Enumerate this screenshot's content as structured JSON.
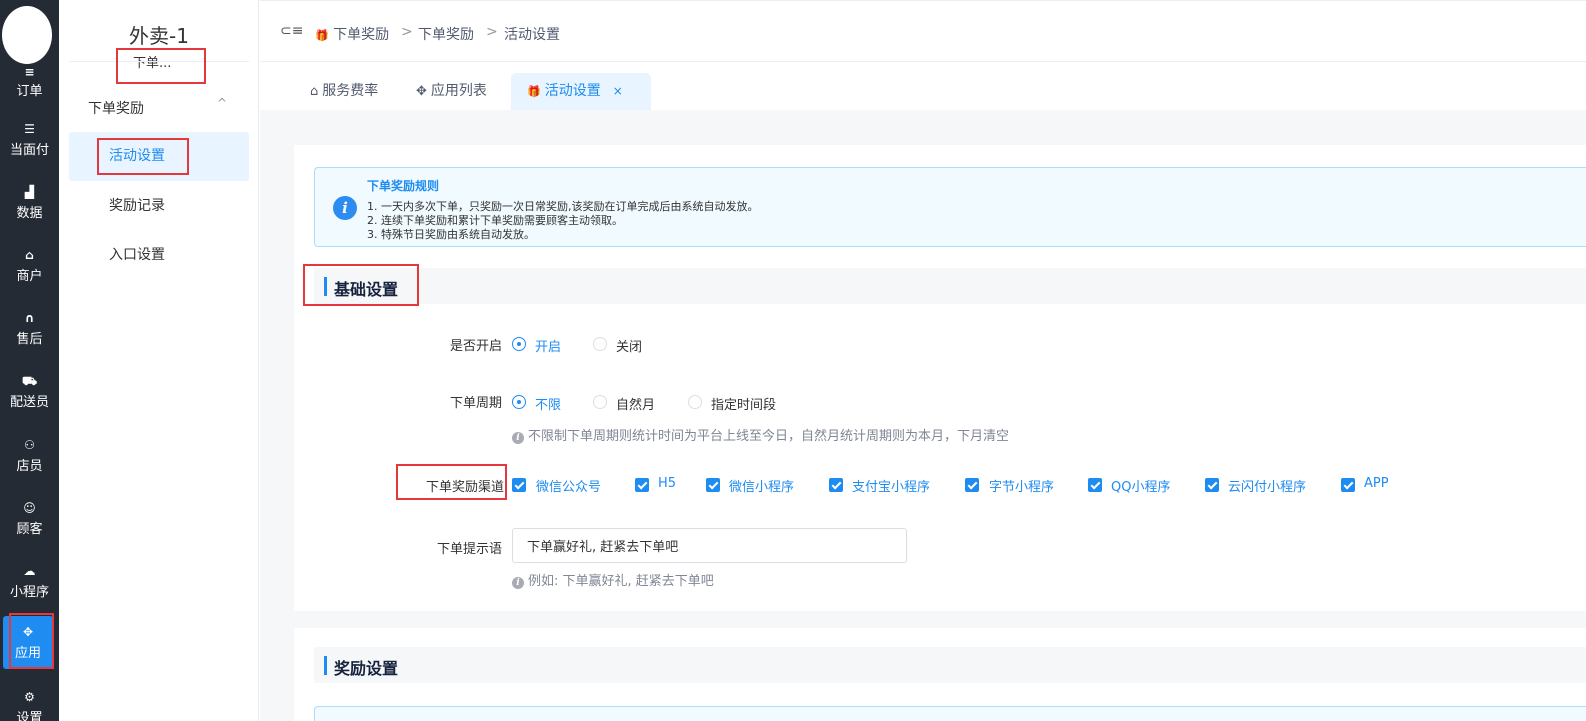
{
  "rail": {
    "items": [
      {
        "label": "订单",
        "icon": "list-icon",
        "glyph": "≡"
      },
      {
        "label": "当面付",
        "icon": "list-icon",
        "glyph": "☰"
      },
      {
        "label": "数据",
        "icon": "bar-chart-icon",
        "glyph": "▟"
      },
      {
        "label": "商户",
        "icon": "store-icon",
        "glyph": "⌂"
      },
      {
        "label": "售后",
        "icon": "headset-icon",
        "glyph": "∩"
      },
      {
        "label": "配送员",
        "icon": "scooter-icon",
        "glyph": "⛟"
      },
      {
        "label": "店员",
        "icon": "users-icon",
        "glyph": "⚇"
      },
      {
        "label": "顾客",
        "icon": "user-circle-icon",
        "glyph": "☺"
      },
      {
        "label": "小程序",
        "icon": "wechat-icon",
        "glyph": "☁"
      },
      {
        "label": "应用",
        "icon": "apps-icon",
        "glyph": "✥"
      },
      {
        "label": "设置",
        "icon": "user-settings-icon",
        "glyph": "⚙"
      }
    ],
    "active_color": "#1e8cf0",
    "bg_color": "#252b34"
  },
  "sidebar": {
    "store_name": "外卖-1",
    "store_sub": "下单...",
    "group_label": "下单奖励",
    "group_caret": "^",
    "items": [
      {
        "label": "活动设置",
        "active": true
      },
      {
        "label": "奖励记录",
        "active": false
      },
      {
        "label": "入口设置",
        "active": false
      }
    ]
  },
  "header": {
    "fold_icon": "⊂≡",
    "breadcrumb": [
      "下单奖励",
      "下单奖励",
      "活动设置"
    ],
    "sep": ">"
  },
  "tabs": [
    {
      "label": "服务费率",
      "icon": "store-icon",
      "glyph": "⌂",
      "active": false
    },
    {
      "label": "应用列表",
      "icon": "apps-icon",
      "glyph": "✥",
      "active": false
    },
    {
      "label": "活动设置",
      "icon": "gift-icon",
      "glyph": "🎁",
      "active": true,
      "close": "×"
    }
  ],
  "notice": {
    "title": "下单奖励规则",
    "lines": [
      "1. 一天内多次下单，只奖励一次日常奖励,该奖励在订单完成后由系统自动发放。",
      "2. 连续下单奖励和累计下单奖励需要顾客主动领取。",
      "3. 特殊节日奖励由系统自动发放。"
    ]
  },
  "basic": {
    "title": "基础设置",
    "enable": {
      "label": "是否开启",
      "options": [
        {
          "label": "开启",
          "checked": true
        },
        {
          "label": "关闭",
          "checked": false
        }
      ]
    },
    "cycle": {
      "label": "下单周期",
      "options": [
        {
          "label": "不限",
          "checked": true
        },
        {
          "label": "自然月",
          "checked": false
        },
        {
          "label": "指定时间段",
          "checked": false
        }
      ],
      "hint": "不限制下单周期则统计时间为平台上线至今日，自然月统计周期则为本月，下月清空"
    },
    "channels": {
      "label": "下单奖励渠道",
      "options": [
        "微信公众号",
        "H5",
        "微信小程序",
        "支付宝小程序",
        "字节小程序",
        "QQ小程序",
        "云闪付小程序",
        "APP"
      ]
    },
    "tip": {
      "label": "下单提示语",
      "value": "下单赢好礼, 赶紧去下单吧",
      "hint": "例如: 下单赢好礼, 赶紧去下单吧"
    }
  },
  "reward": {
    "title": "奖励设置"
  },
  "colors": {
    "accent": "#1e8cf0",
    "annotation_red": "#e4393c"
  }
}
